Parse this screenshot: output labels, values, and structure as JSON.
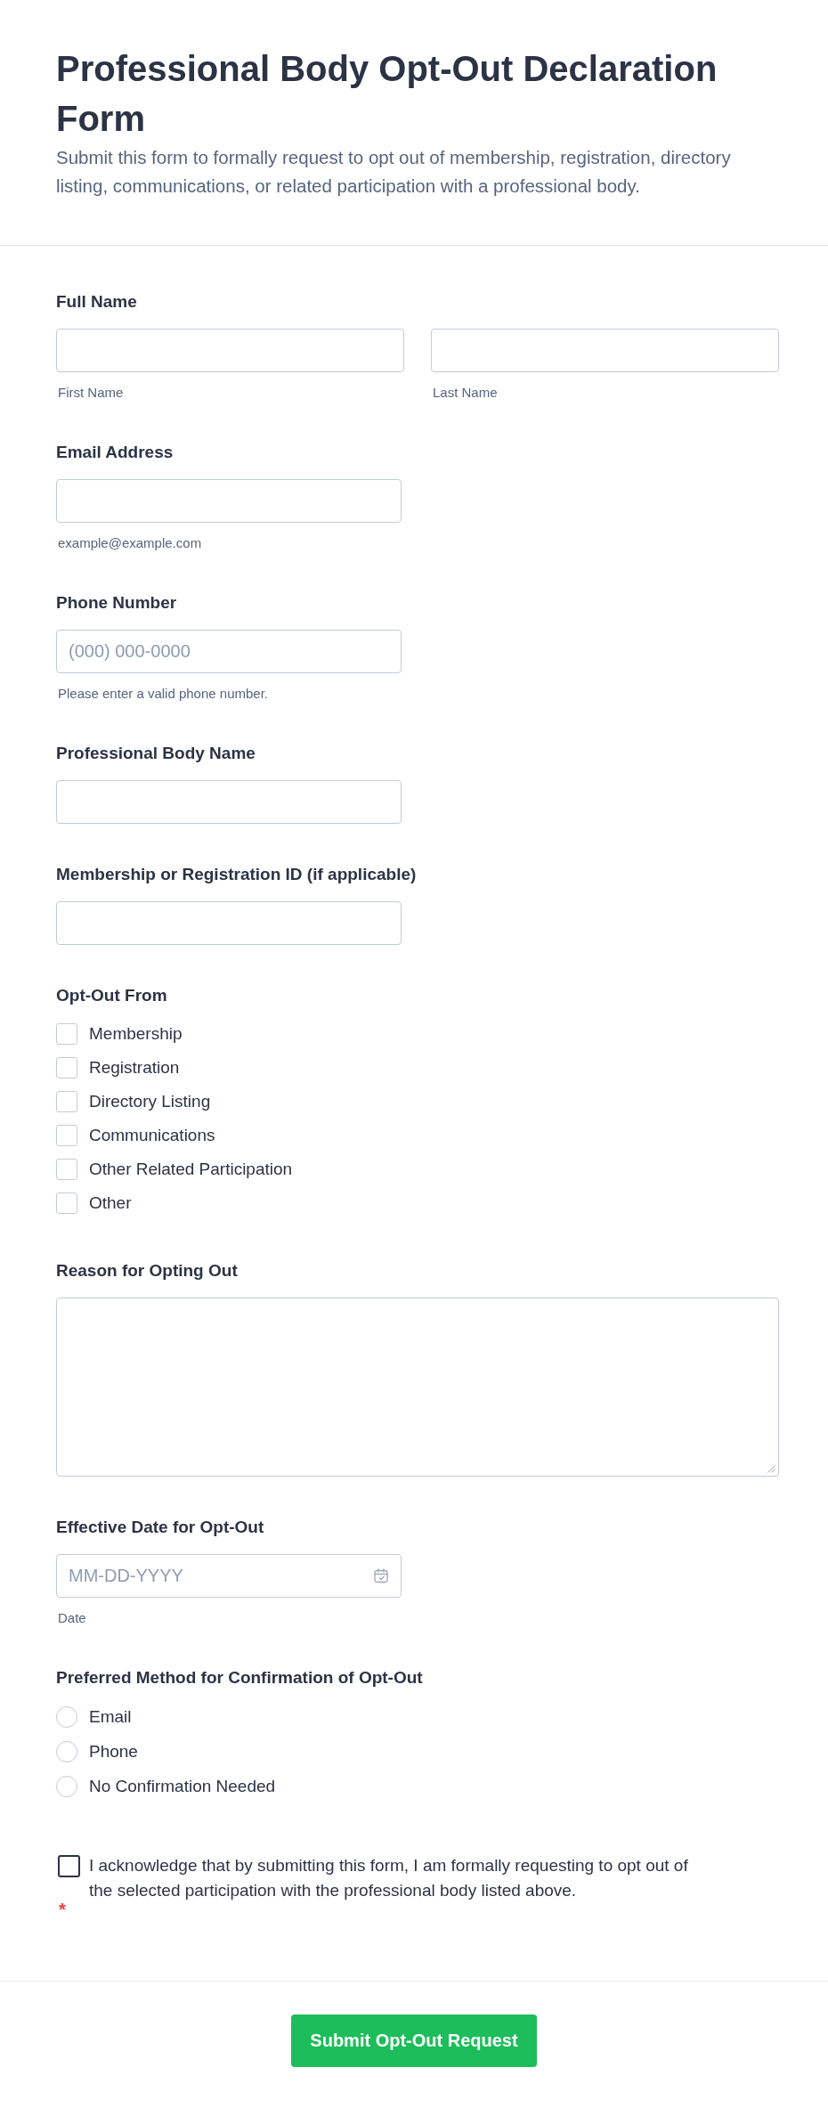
{
  "header": {
    "title": "Professional Body Opt-Out Declaration Form",
    "description": "Submit this form to formally request to opt out of membership, registration, directory listing, communications, or related participation with a professional body."
  },
  "fields": [
    {
      "kind": "name",
      "label": "Full Name",
      "inputs": [
        {
          "sublabel": "First Name"
        },
        {
          "sublabel": "Last Name"
        }
      ]
    },
    {
      "kind": "text",
      "label": "Email Address",
      "sublabel": "example@example.com"
    },
    {
      "kind": "text",
      "label": "Phone Number",
      "placeholder": "(000) 000-0000",
      "sublabel": "Please enter a valid phone number."
    },
    {
      "kind": "text",
      "label": "Professional Body Name"
    },
    {
      "kind": "text",
      "label": "Membership or Registration ID (if applicable)"
    },
    {
      "kind": "checkboxes",
      "label": "Opt-Out From",
      "options": [
        {
          "label": "Membership",
          "checked": false
        },
        {
          "label": "Registration",
          "checked": false
        },
        {
          "label": "Directory Listing",
          "checked": false
        },
        {
          "label": "Communications",
          "checked": false
        },
        {
          "label": "Other Related Participation",
          "checked": false
        },
        {
          "label": "Other",
          "checked": false
        }
      ]
    },
    {
      "kind": "textarea",
      "label": "Reason for Opting Out"
    },
    {
      "kind": "date",
      "label": "Effective Date for Opt-Out",
      "placeholder": "MM-DD-YYYY",
      "sublabel": "Date"
    },
    {
      "kind": "radios",
      "label": "Preferred Method for Confirmation of Opt-Out",
      "options": [
        {
          "label": "Email",
          "selected": false
        },
        {
          "label": "Phone",
          "selected": false
        },
        {
          "label": "No Confirmation Needed",
          "selected": false
        }
      ]
    }
  ],
  "acknowledgement": {
    "checked": false,
    "text": "I acknowledge that by submitting this form, I am formally requesting to opt out of the selected participation with the professional body listed above.",
    "required_mark": "*"
  },
  "submit_button": "Submit Opt-Out Request"
}
